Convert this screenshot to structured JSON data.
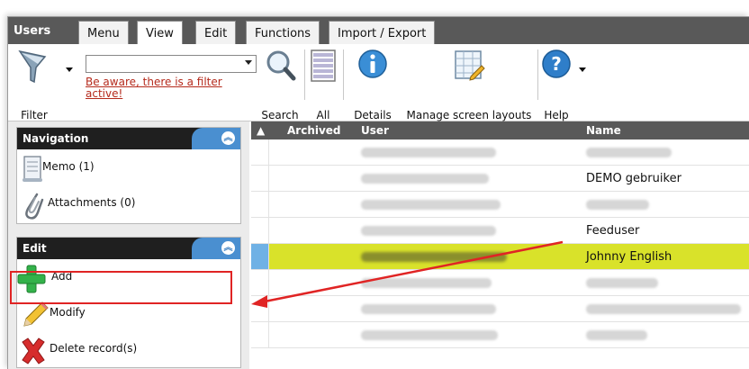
{
  "app": {
    "title": "Users"
  },
  "tabs": [
    {
      "label": "Menu"
    },
    {
      "label": "View",
      "active": true
    },
    {
      "label": "Edit"
    },
    {
      "label": "Functions"
    },
    {
      "label": "Import / Export"
    }
  ],
  "toolbar": {
    "filter_label": "Filter",
    "filter_value": "",
    "filter_warning": "Be aware, there is a filter active!",
    "search_label": "Search",
    "all_label": "All",
    "details_label": "Details",
    "layouts_label": "Manage screen layouts",
    "help_label": "Help"
  },
  "navigation": {
    "title": "Navigation",
    "items": [
      {
        "label": "Memo (1)",
        "icon": "memo-icon"
      },
      {
        "label": "Attachments (0)",
        "icon": "paperclip-icon"
      }
    ]
  },
  "edit": {
    "title": "Edit",
    "items": [
      {
        "label": "Add",
        "icon": "plus-icon"
      },
      {
        "label": "Modify",
        "icon": "pencil-icon"
      },
      {
        "label": "Delete record(s)",
        "icon": "delete-x-icon"
      }
    ]
  },
  "grid": {
    "columns": [
      "Archived",
      "User",
      "Name"
    ],
    "rows": [
      {
        "name": ""
      },
      {
        "name": "DEMO gebruiker"
      },
      {
        "name": ""
      },
      {
        "name": "Feeduser"
      },
      {
        "name": "Johnny English",
        "selected": true
      },
      {
        "name": ""
      },
      {
        "name": ""
      },
      {
        "name": ""
      }
    ]
  },
  "colors": {
    "accent_blue": "#4a8fd0",
    "selection_yellow": "#d9e22a",
    "warning_red": "#b52a1c",
    "annotation_red": "#e02424"
  }
}
